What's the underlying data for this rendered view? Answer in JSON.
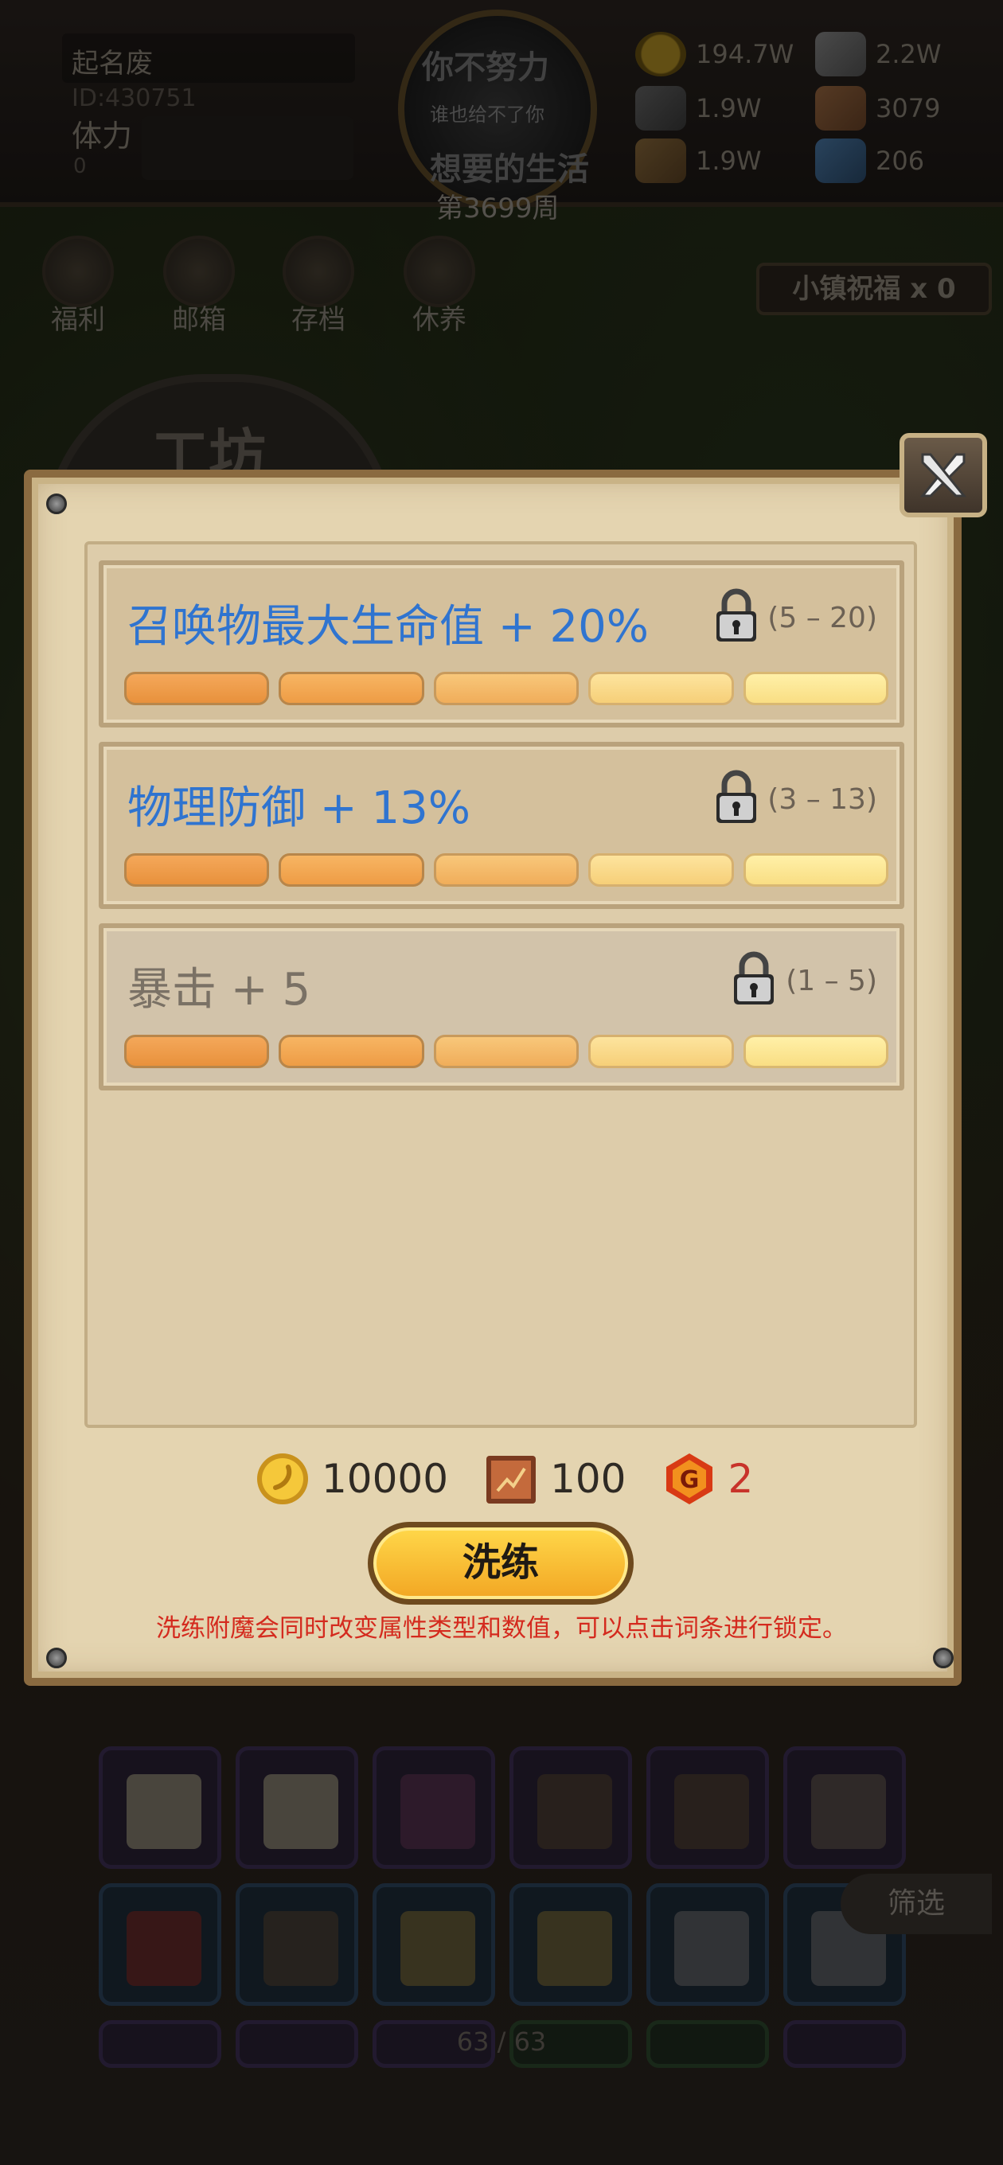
{
  "player": {
    "name": "起名废",
    "id": "ID:430751",
    "stamina_label": "体力",
    "stamina_value": "0"
  },
  "banner": {
    "line1": "你不努力",
    "line2": "谁也给不了你",
    "line3": "想要的生活",
    "week": "第3699周"
  },
  "resources": [
    {
      "icon": "gold-coin-icon",
      "value": "194.7W"
    },
    {
      "icon": "iron-ingot-icon",
      "value": "2.2W"
    },
    {
      "icon": "stone-icon",
      "value": "1.9W"
    },
    {
      "icon": "cloth-icon",
      "value": "3079"
    },
    {
      "icon": "wood-log-icon",
      "value": "1.9W"
    },
    {
      "icon": "crystal-icon",
      "value": "206"
    }
  ],
  "menu": [
    {
      "label": "福利",
      "icon": "shield-icon"
    },
    {
      "label": "邮箱",
      "icon": "mail-icon"
    },
    {
      "label": "存档",
      "icon": "scroll-icon"
    },
    {
      "label": "休养",
      "icon": "bed-icon"
    }
  ],
  "blessing_label": "小镇祝福 x 0",
  "workshop_title": "工坊",
  "filter_label": "筛选",
  "pager_text": "63 / 63",
  "modal": {
    "attributes": [
      {
        "text": "召唤物最大生命值 + 20%",
        "range": "(5 – 20)",
        "level": 5,
        "locked": false
      },
      {
        "text": "物理防御 + 13%",
        "range": "(3 – 13)",
        "level": 5,
        "locked": false
      },
      {
        "text": "暴击 + 5",
        "range": "(1 – 5)",
        "level": 5,
        "locked": false
      }
    ],
    "cost": {
      "gold": "10000",
      "cloth": "100",
      "gem": "2"
    },
    "refine_label": "洗练",
    "hint": "洗练附魔会同时改变属性类型和数值，可以点击词条进行锁定。"
  },
  "colors": {
    "attr_blue": "#2f74d0",
    "hint_red": "#d42a1e",
    "button_gold": "#f2a623"
  }
}
